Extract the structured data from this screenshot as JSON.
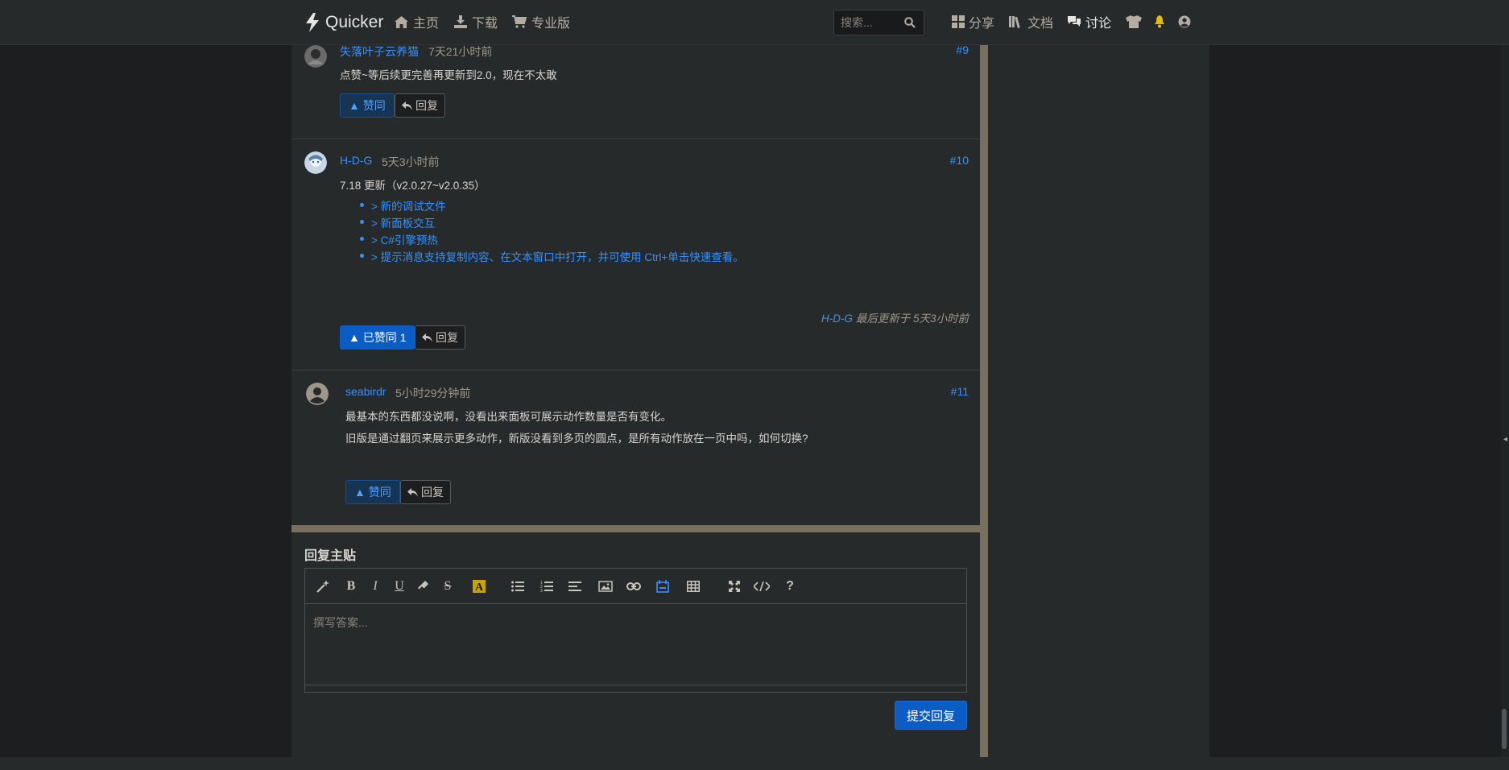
{
  "navbar": {
    "brand": "Quicker",
    "home": "主页",
    "download": "下载",
    "pro": "专业版",
    "search_placeholder": "搜索...",
    "share": "分享",
    "docs": "文档",
    "discuss": "讨论"
  },
  "posts": [
    {
      "author": "失落叶子云养猫",
      "time": "7天21小时前",
      "num": "#9",
      "lines": [
        "点赞~等后续更完善再更新到2.0，现在不太敢"
      ],
      "upvote": "▲ 赞同",
      "reply": "回复"
    },
    {
      "author": "H-D-G",
      "time": "5天3小时前",
      "num": "#10",
      "lines": [
        "7.18 更新（v2.0.27~v2.0.35）"
      ],
      "list": [
        "> 新的调试文件",
        "> 新面板交互",
        "> C#引擎预热",
        "> 提示消息支持复制内容、在文本窗口中打开，并可使用 Ctrl+单击快速查看。"
      ],
      "last_update_user": "H-D-G",
      "last_update_text": " 最后更新于 5天3小时前",
      "upvote": "▲ 已赞同 1",
      "reply": "回复"
    },
    {
      "author": "seabirdr",
      "time": "5小时29分钟前",
      "num": "#11",
      "lines": [
        "最基本的东西都没说啊，没看出来面板可展示动作数量是否有变化。",
        "旧版是通过翻页来展示更多动作，新版没看到多页的圆点，是所有动作放在一页中吗，如何切换?"
      ],
      "upvote": "▲ 赞同",
      "reply": "回复"
    }
  ],
  "reply_section": {
    "title": "回复主贴",
    "placeholder": "撰写答案...",
    "submit": "提交回复",
    "toolbar_icons": [
      "magic-icon",
      "bold-icon",
      "italic-icon",
      "underline-icon",
      "eraser-icon",
      "strikethrough-icon",
      "highlight-icon",
      "bullet-list-icon",
      "numbered-list-icon",
      "align-icon",
      "image-icon",
      "link-icon",
      "calendar-icon",
      "table-icon",
      "fullscreen-icon",
      "code-icon",
      "help-icon"
    ]
  },
  "colors": {
    "accent": "#3391ff",
    "primary_button": "#0b5cc4",
    "page_bg": "#262a2b",
    "divider": "#77705f"
  }
}
